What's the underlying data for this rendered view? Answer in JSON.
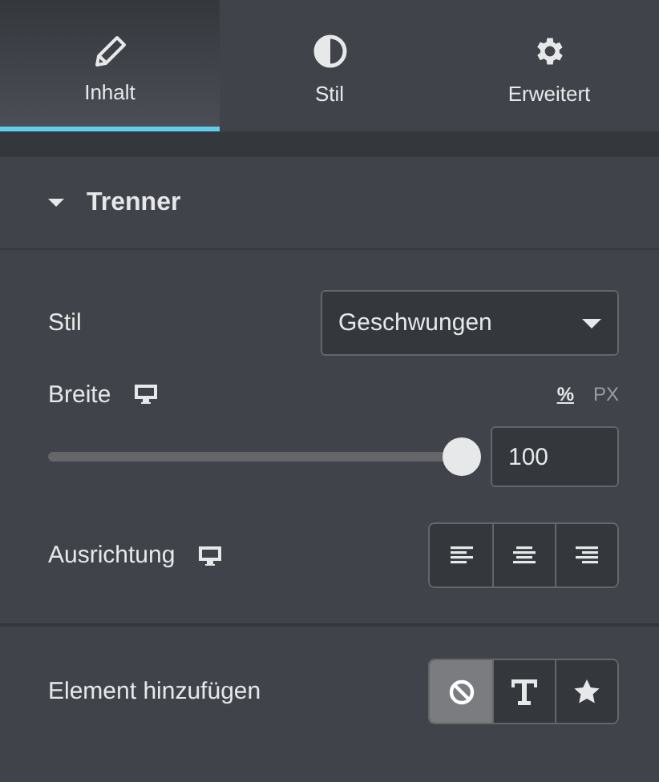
{
  "tabs": [
    {
      "label": "Inhalt",
      "kind": "pencil",
      "selected": true
    },
    {
      "label": "Stil",
      "kind": "contrast",
      "selected": false
    },
    {
      "label": "Erweitert",
      "kind": "gear",
      "selected": false
    }
  ],
  "section": {
    "title": "Trenner",
    "expanded": true
  },
  "style_control": {
    "label": "Stil",
    "value": "Geschwungen"
  },
  "width_control": {
    "label": "Breite",
    "units": [
      {
        "label": "%",
        "selected": true
      },
      {
        "label": "PX",
        "selected": false
      }
    ],
    "level": 1,
    "value": "100"
  },
  "alignment_control": {
    "label": "Ausrichtung",
    "options": [
      {
        "kind": "left",
        "selected": false
      },
      {
        "kind": "center",
        "selected": false
      },
      {
        "kind": "right",
        "selected": false
      }
    ]
  },
  "add_element_control": {
    "label": "Element hinzufügen",
    "options": [
      {
        "kind": "none",
        "selected": true
      },
      {
        "kind": "text",
        "selected": false
      },
      {
        "kind": "icon",
        "selected": false
      }
    ]
  }
}
